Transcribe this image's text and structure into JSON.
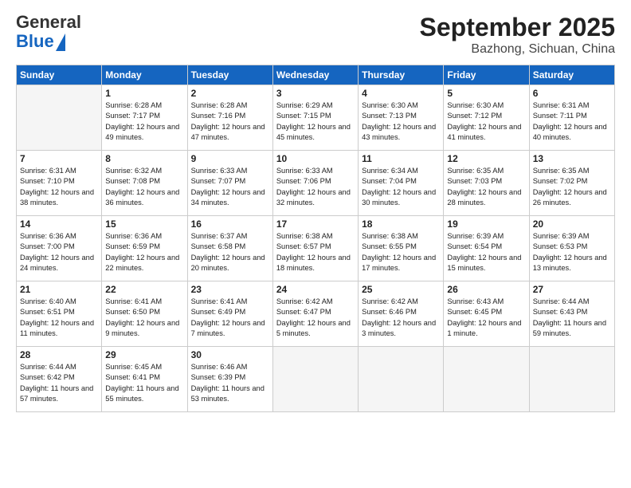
{
  "logo": {
    "general": "General",
    "blue": "Blue"
  },
  "title": "September 2025",
  "location": "Bazhong, Sichuan, China",
  "days_of_week": [
    "Sunday",
    "Monday",
    "Tuesday",
    "Wednesday",
    "Thursday",
    "Friday",
    "Saturday"
  ],
  "weeks": [
    [
      {
        "day": "",
        "info": ""
      },
      {
        "day": "1",
        "info": "Sunrise: 6:28 AM\nSunset: 7:17 PM\nDaylight: 12 hours\nand 49 minutes."
      },
      {
        "day": "2",
        "info": "Sunrise: 6:28 AM\nSunset: 7:16 PM\nDaylight: 12 hours\nand 47 minutes."
      },
      {
        "day": "3",
        "info": "Sunrise: 6:29 AM\nSunset: 7:15 PM\nDaylight: 12 hours\nand 45 minutes."
      },
      {
        "day": "4",
        "info": "Sunrise: 6:30 AM\nSunset: 7:13 PM\nDaylight: 12 hours\nand 43 minutes."
      },
      {
        "day": "5",
        "info": "Sunrise: 6:30 AM\nSunset: 7:12 PM\nDaylight: 12 hours\nand 41 minutes."
      },
      {
        "day": "6",
        "info": "Sunrise: 6:31 AM\nSunset: 7:11 PM\nDaylight: 12 hours\nand 40 minutes."
      }
    ],
    [
      {
        "day": "7",
        "info": "Sunrise: 6:31 AM\nSunset: 7:10 PM\nDaylight: 12 hours\nand 38 minutes."
      },
      {
        "day": "8",
        "info": "Sunrise: 6:32 AM\nSunset: 7:08 PM\nDaylight: 12 hours\nand 36 minutes."
      },
      {
        "day": "9",
        "info": "Sunrise: 6:33 AM\nSunset: 7:07 PM\nDaylight: 12 hours\nand 34 minutes."
      },
      {
        "day": "10",
        "info": "Sunrise: 6:33 AM\nSunset: 7:06 PM\nDaylight: 12 hours\nand 32 minutes."
      },
      {
        "day": "11",
        "info": "Sunrise: 6:34 AM\nSunset: 7:04 PM\nDaylight: 12 hours\nand 30 minutes."
      },
      {
        "day": "12",
        "info": "Sunrise: 6:35 AM\nSunset: 7:03 PM\nDaylight: 12 hours\nand 28 minutes."
      },
      {
        "day": "13",
        "info": "Sunrise: 6:35 AM\nSunset: 7:02 PM\nDaylight: 12 hours\nand 26 minutes."
      }
    ],
    [
      {
        "day": "14",
        "info": "Sunrise: 6:36 AM\nSunset: 7:00 PM\nDaylight: 12 hours\nand 24 minutes."
      },
      {
        "day": "15",
        "info": "Sunrise: 6:36 AM\nSunset: 6:59 PM\nDaylight: 12 hours\nand 22 minutes."
      },
      {
        "day": "16",
        "info": "Sunrise: 6:37 AM\nSunset: 6:58 PM\nDaylight: 12 hours\nand 20 minutes."
      },
      {
        "day": "17",
        "info": "Sunrise: 6:38 AM\nSunset: 6:57 PM\nDaylight: 12 hours\nand 18 minutes."
      },
      {
        "day": "18",
        "info": "Sunrise: 6:38 AM\nSunset: 6:55 PM\nDaylight: 12 hours\nand 17 minutes."
      },
      {
        "day": "19",
        "info": "Sunrise: 6:39 AM\nSunset: 6:54 PM\nDaylight: 12 hours\nand 15 minutes."
      },
      {
        "day": "20",
        "info": "Sunrise: 6:39 AM\nSunset: 6:53 PM\nDaylight: 12 hours\nand 13 minutes."
      }
    ],
    [
      {
        "day": "21",
        "info": "Sunrise: 6:40 AM\nSunset: 6:51 PM\nDaylight: 12 hours\nand 11 minutes."
      },
      {
        "day": "22",
        "info": "Sunrise: 6:41 AM\nSunset: 6:50 PM\nDaylight: 12 hours\nand 9 minutes."
      },
      {
        "day": "23",
        "info": "Sunrise: 6:41 AM\nSunset: 6:49 PM\nDaylight: 12 hours\nand 7 minutes."
      },
      {
        "day": "24",
        "info": "Sunrise: 6:42 AM\nSunset: 6:47 PM\nDaylight: 12 hours\nand 5 minutes."
      },
      {
        "day": "25",
        "info": "Sunrise: 6:42 AM\nSunset: 6:46 PM\nDaylight: 12 hours\nand 3 minutes."
      },
      {
        "day": "26",
        "info": "Sunrise: 6:43 AM\nSunset: 6:45 PM\nDaylight: 12 hours\nand 1 minute."
      },
      {
        "day": "27",
        "info": "Sunrise: 6:44 AM\nSunset: 6:43 PM\nDaylight: 11 hours\nand 59 minutes."
      }
    ],
    [
      {
        "day": "28",
        "info": "Sunrise: 6:44 AM\nSunset: 6:42 PM\nDaylight: 11 hours\nand 57 minutes."
      },
      {
        "day": "29",
        "info": "Sunrise: 6:45 AM\nSunset: 6:41 PM\nDaylight: 11 hours\nand 55 minutes."
      },
      {
        "day": "30",
        "info": "Sunrise: 6:46 AM\nSunset: 6:39 PM\nDaylight: 11 hours\nand 53 minutes."
      },
      {
        "day": "",
        "info": ""
      },
      {
        "day": "",
        "info": ""
      },
      {
        "day": "",
        "info": ""
      },
      {
        "day": "",
        "info": ""
      }
    ]
  ]
}
